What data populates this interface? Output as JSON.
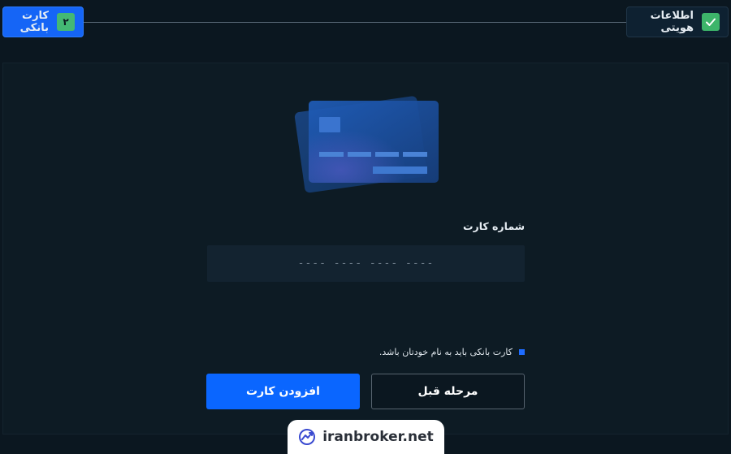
{
  "stepper": {
    "steps": [
      {
        "label": "اطلاعات هویتی",
        "badge": "✓",
        "status": "completed"
      },
      {
        "label": "کارت بانکی",
        "badge": "۲",
        "status": "active"
      }
    ]
  },
  "form": {
    "card_number_label": "شماره کارت",
    "card_number_placeholder": "---- ---- ---- ----",
    "card_number_value": "",
    "note": "کارت بانکی باید به نام خودتان باشد."
  },
  "buttons": {
    "add_card": "افزودن کارت",
    "previous_step": "مرحله قبل"
  },
  "watermark": {
    "text": "iranbroker.net",
    "icon": "chart-trend-icon"
  },
  "colors": {
    "background": "#0b1720",
    "panel": "#0d1b24",
    "primary": "#0a66ff",
    "success": "#3db56a",
    "input_bg": "#132330"
  }
}
